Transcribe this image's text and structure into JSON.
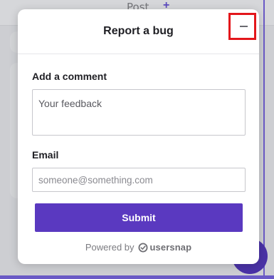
{
  "background": {
    "post_label": "Post",
    "plus_label": "+"
  },
  "modal": {
    "title": "Report a bug",
    "minimize_icon": "minimize-icon",
    "comment_label": "Add a comment",
    "comment_placeholder": "Your feedback",
    "comment_value": "",
    "email_label": "Email",
    "email_placeholder": "someone@something.com",
    "email_value": "",
    "submit_label": "Submit",
    "powered_by": "Powered by",
    "brand_name": "usersnap",
    "brand_icon": "usersnap-logo-icon"
  },
  "colors": {
    "accent": "#5a39c0",
    "highlight_box": "#e3161b",
    "background_overlay": "#cdced2"
  }
}
